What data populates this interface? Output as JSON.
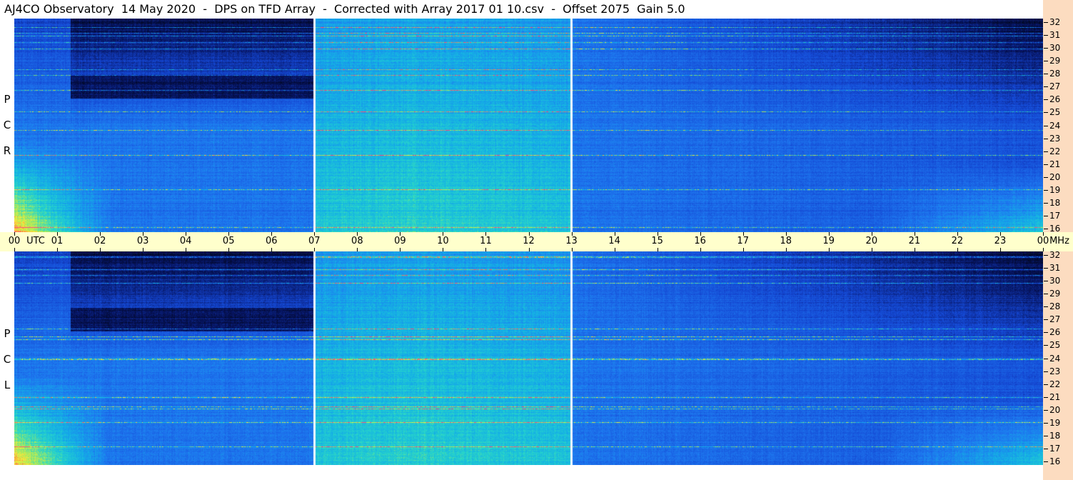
{
  "title": "AJ4CO Observatory  14 May 2020  -  DPS on TFD Array  -  Corrected with Array 2017 01 10.csv  -  Offset 2075  Gain 5.0",
  "chart_data": {
    "type": "heatmap",
    "title": "AJ4CO Observatory  14 May 2020  -  DPS on TFD Array  -  Corrected with Array 2017 01 10.csv  -  Offset 2075  Gain 5.0",
    "x_unit": "UTC",
    "y_unit": "MHz",
    "x_ticks": [
      "00",
      "01",
      "02",
      "03",
      "04",
      "05",
      "06",
      "07",
      "08",
      "09",
      "10",
      "11",
      "12",
      "13",
      "14",
      "15",
      "16",
      "17",
      "18",
      "19",
      "20",
      "21",
      "22",
      "23",
      "00"
    ],
    "y_ticks": [
      "32",
      "31",
      "30",
      "29",
      "28",
      "27",
      "26",
      "25",
      "24",
      "23",
      "22",
      "21",
      "20",
      "19",
      "18",
      "17",
      "16"
    ],
    "xlim_hours": [
      0,
      24
    ],
    "ylim_mhz": [
      16,
      32
    ],
    "calibration_lines_utc_hours": [
      7,
      13
    ],
    "panels": [
      {
        "polarization": "RCP",
        "letters": [
          "P",
          "C",
          "R"
        ]
      },
      {
        "polarization": "LCP",
        "letters": [
          "P",
          "C",
          "L"
        ]
      }
    ],
    "colors": {
      "frequency_rail": "#fcdcc0",
      "time_band": "#ffffcc",
      "low_intensity": "#000820",
      "mid_intensity": "#1e64f0",
      "high_intensity": "#ffeb3c"
    }
  }
}
